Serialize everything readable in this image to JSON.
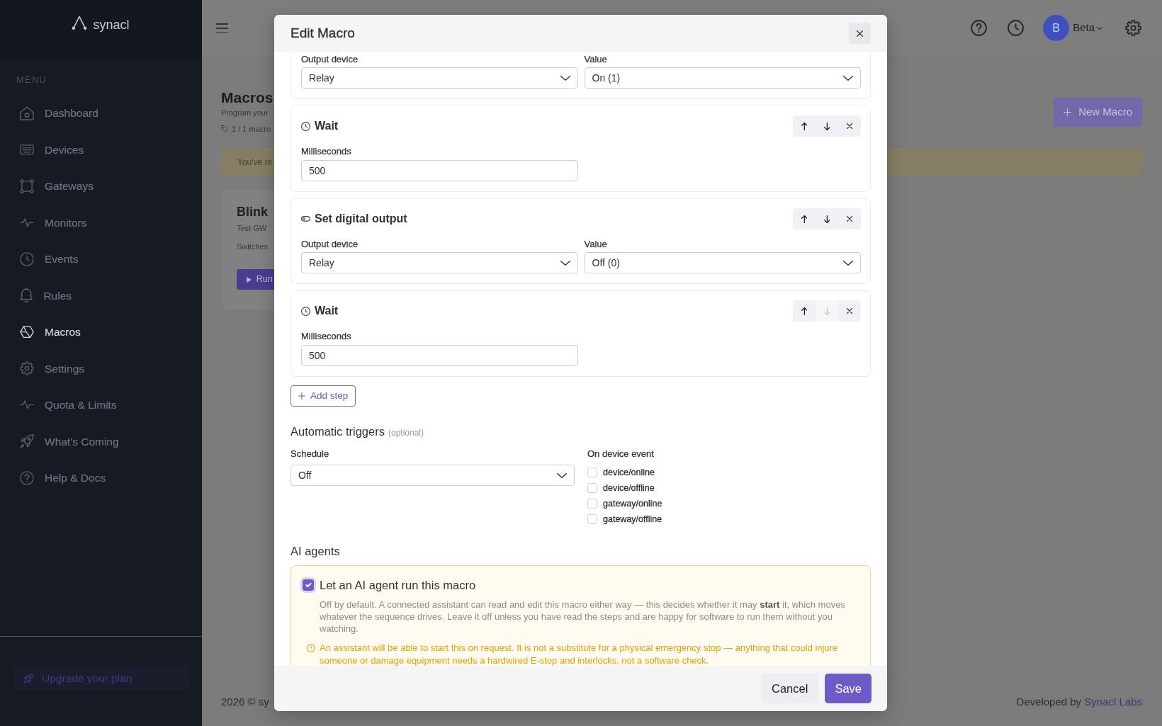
{
  "sidebar": {
    "logo": "synacl",
    "section": "MENU",
    "items": [
      {
        "label": "Dashboard",
        "selected": false
      },
      {
        "label": "Devices",
        "selected": false
      },
      {
        "label": "Gateways",
        "selected": false
      },
      {
        "label": "Monitors",
        "selected": false
      },
      {
        "label": "Events",
        "selected": false
      },
      {
        "label": "Rules",
        "selected": false
      },
      {
        "label": "Macros",
        "selected": true
      },
      {
        "label": "Settings",
        "selected": false
      },
      {
        "label": "Quota & Limits",
        "selected": false
      },
      {
        "label": "What's Coming",
        "selected": false
      },
      {
        "label": "Help & Docs",
        "selected": false
      }
    ],
    "upgrade": "Upgrade your plan"
  },
  "header": {
    "avatar": "B",
    "user": "Beta"
  },
  "page": {
    "title": "Macros",
    "subtitle": "Program your",
    "count": "1 / 1 macro",
    "new_button": "New Macro",
    "alert": "You've re",
    "card": {
      "title": "Blink",
      "gateway": "Test GW",
      "description": "Switches",
      "run_button": "Run"
    }
  },
  "footer": {
    "copyright": "2026 © sy",
    "credit": "Developed by",
    "credit_link": "Synacl Labs"
  },
  "modal": {
    "title": "Edit Macro",
    "steps": [
      {
        "kind": "output",
        "fields": [
          {
            "label": "Output device",
            "value": "Relay"
          },
          {
            "label": "Value",
            "value": "On (1)"
          }
        ]
      },
      {
        "kind": "wait",
        "title": "Wait",
        "down_disabled": false,
        "fields": [
          {
            "label": "Milliseconds",
            "value": "500"
          }
        ]
      },
      {
        "kind": "output",
        "title": "Set digital output",
        "down_disabled": false,
        "fields": [
          {
            "label": "Output device",
            "value": "Relay"
          },
          {
            "label": "Value",
            "value": "Off (0)"
          }
        ]
      },
      {
        "kind": "wait",
        "title": "Wait",
        "down_disabled": true,
        "fields": [
          {
            "label": "Milliseconds",
            "value": "500"
          }
        ]
      }
    ],
    "add_step": "Add step",
    "triggers": {
      "title": "Automatic triggers",
      "hint": "(optional)",
      "schedule_label": "Schedule",
      "schedule": "Off",
      "events_label": "On device event",
      "events": [
        {
          "label": "device/online",
          "checked": false
        },
        {
          "label": "device/offline",
          "checked": false
        },
        {
          "label": "gateway/online",
          "checked": false
        },
        {
          "label": "gateway/offline",
          "checked": false
        }
      ]
    },
    "ai": {
      "title": "AI agents",
      "label": "Let an AI agent run this macro",
      "checked": true,
      "description": "Off by default. A connected assistant can read and edit this macro either way — this decides whether it may **start** it, which moves whatever the sequence drives. Leave it off unless you have read the steps and are happy for software to run them without you watching.",
      "warning": "An assistant will be able to start this on request. It is not a substitute for a physical emergency stop — anything that could injure someone or damage equipment needs a hardwired E-stop and interlocks, not a software check."
    },
    "cancel": "Cancel",
    "save": "Save"
  }
}
